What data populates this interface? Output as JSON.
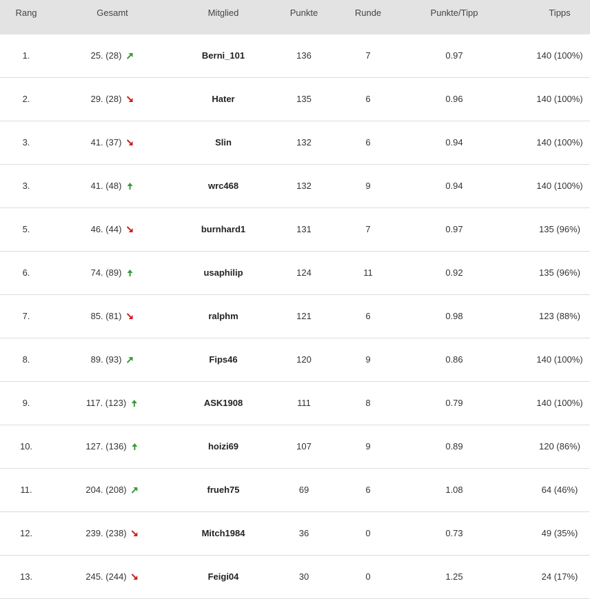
{
  "headers": {
    "rang": "Rang",
    "gesamt": "Gesamt",
    "mitglied": "Mitglied",
    "punkte": "Punkte",
    "runde": "Runde",
    "punkte_tipp": "Punkte/Tipp",
    "tipps": "Tipps"
  },
  "colors": {
    "up": "#3a9a3a",
    "down": "#cc2222",
    "header_bg": "#e3e3e3"
  },
  "rows": [
    {
      "rang": "1.",
      "gesamt": "25. (28)",
      "trend": "up-right-icon",
      "mitglied": "Berni_101",
      "punkte": "136",
      "runde": "7",
      "punkte_tipp": "0.97",
      "tipps": "140 (100%)"
    },
    {
      "rang": "2.",
      "gesamt": "29. (28)",
      "trend": "down-right-icon",
      "mitglied": "Hater",
      "punkte": "135",
      "runde": "6",
      "punkte_tipp": "0.96",
      "tipps": "140 (100%)"
    },
    {
      "rang": "3.",
      "gesamt": "41. (37)",
      "trend": "down-right-icon",
      "mitglied": "Slin",
      "punkte": "132",
      "runde": "6",
      "punkte_tipp": "0.94",
      "tipps": "140 (100%)"
    },
    {
      "rang": "3.",
      "gesamt": "41. (48)",
      "trend": "up-icon",
      "mitglied": "wrc468",
      "punkte": "132",
      "runde": "9",
      "punkte_tipp": "0.94",
      "tipps": "140 (100%)"
    },
    {
      "rang": "5.",
      "gesamt": "46. (44)",
      "trend": "down-right-icon",
      "mitglied": "burnhard1",
      "punkte": "131",
      "runde": "7",
      "punkte_tipp": "0.97",
      "tipps": "135 (96%)"
    },
    {
      "rang": "6.",
      "gesamt": "74. (89)",
      "trend": "up-icon",
      "mitglied": "usaphilip",
      "punkte": "124",
      "runde": "11",
      "punkte_tipp": "0.92",
      "tipps": "135 (96%)"
    },
    {
      "rang": "7.",
      "gesamt": "85. (81)",
      "trend": "down-right-icon",
      "mitglied": "ralphm",
      "punkte": "121",
      "runde": "6",
      "punkte_tipp": "0.98",
      "tipps": "123 (88%)"
    },
    {
      "rang": "8.",
      "gesamt": "89. (93)",
      "trend": "up-right-icon",
      "mitglied": "Fips46",
      "punkte": "120",
      "runde": "9",
      "punkte_tipp": "0.86",
      "tipps": "140 (100%)"
    },
    {
      "rang": "9.",
      "gesamt": "117. (123)",
      "trend": "up-icon",
      "mitglied": "ASK1908",
      "punkte": "111",
      "runde": "8",
      "punkte_tipp": "0.79",
      "tipps": "140 (100%)"
    },
    {
      "rang": "10.",
      "gesamt": "127. (136)",
      "trend": "up-icon",
      "mitglied": "hoizi69",
      "punkte": "107",
      "runde": "9",
      "punkte_tipp": "0.89",
      "tipps": "120 (86%)"
    },
    {
      "rang": "11.",
      "gesamt": "204. (208)",
      "trend": "up-right-icon",
      "mitglied": "frueh75",
      "punkte": "69",
      "runde": "6",
      "punkte_tipp": "1.08",
      "tipps": "64 (46%)"
    },
    {
      "rang": "12.",
      "gesamt": "239. (238)",
      "trend": "down-right-icon",
      "mitglied": "Mitch1984",
      "punkte": "36",
      "runde": "0",
      "punkte_tipp": "0.73",
      "tipps": "49 (35%)"
    },
    {
      "rang": "13.",
      "gesamt": "245. (244)",
      "trend": "down-right-icon",
      "mitglied": "Feigi04",
      "punkte": "30",
      "runde": "0",
      "punkte_tipp": "1.25",
      "tipps": "24 (17%)"
    }
  ]
}
